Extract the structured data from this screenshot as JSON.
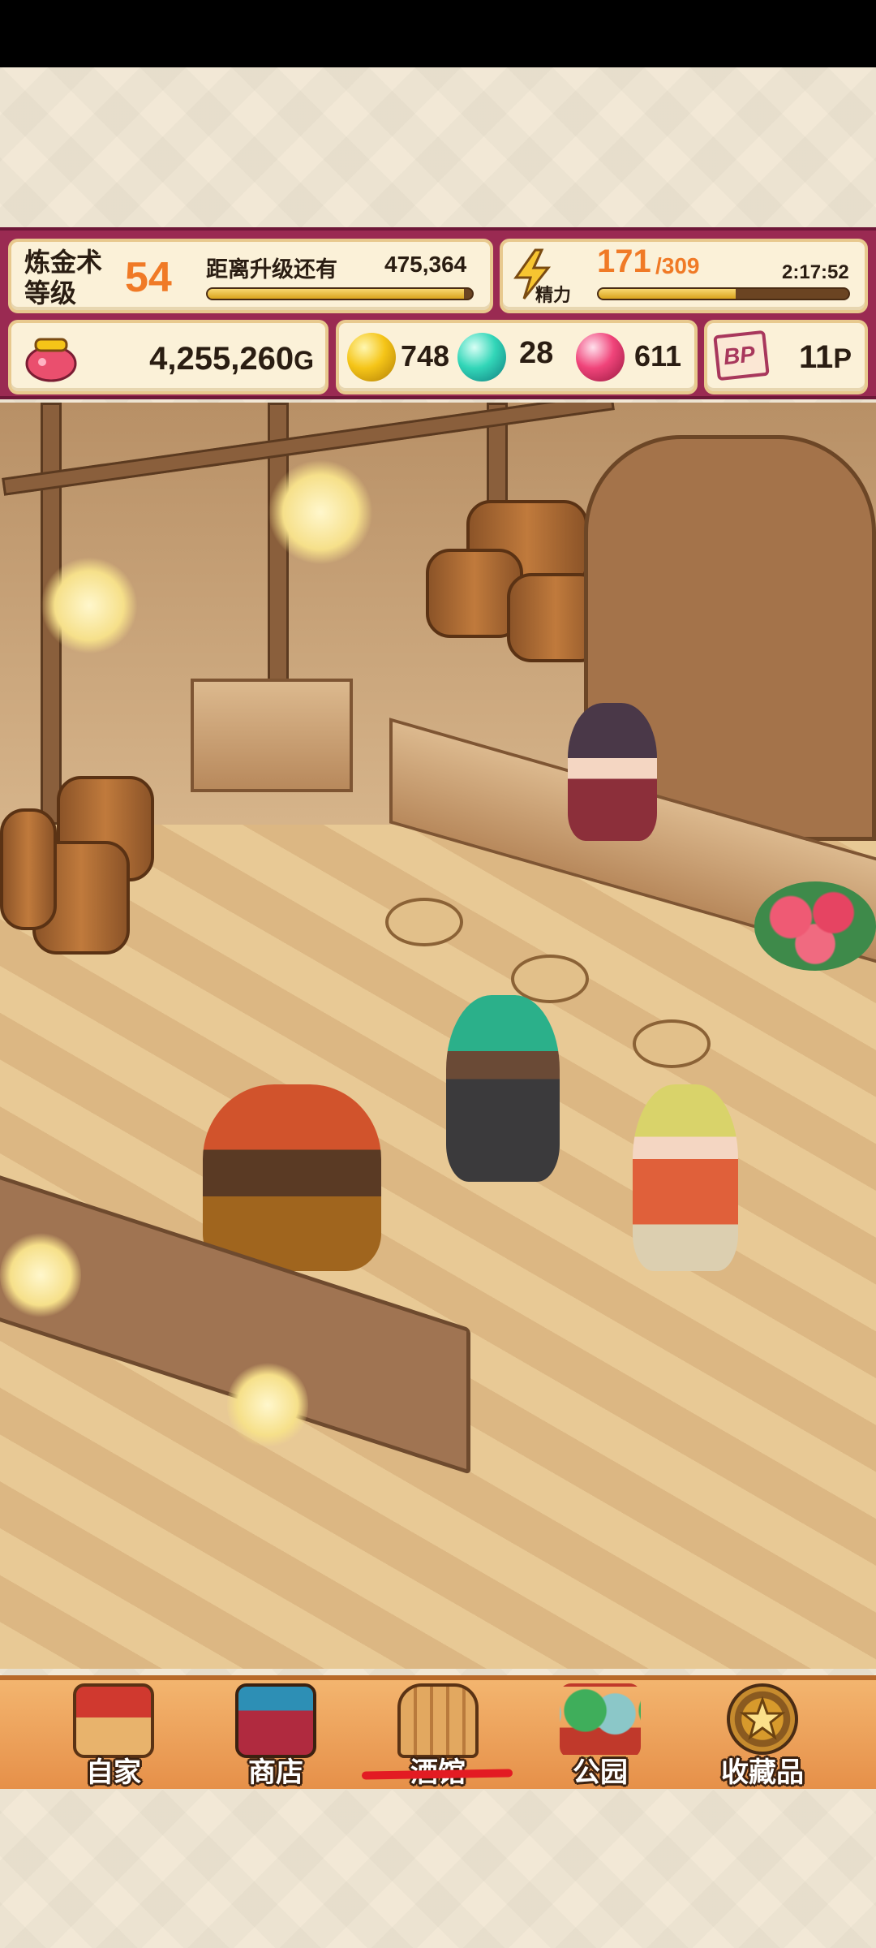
{
  "hud": {
    "alchemy_label": "炼金术\n等级",
    "alchemy_level": "54",
    "next_level_label": "距离升级还有",
    "next_level_value": "475,364",
    "exp_progress": 0.97,
    "energy_label": "精力",
    "energy_current": "171",
    "energy_max": "/309",
    "energy_timer": "2:17:52",
    "energy_progress": 0.55,
    "gold_value": "4,255,260",
    "gold_unit": "G",
    "gold_gem_count": "748",
    "cyan_gem_count": "28",
    "pink_gem_count": "611",
    "bp_icon_text": "BP",
    "bp_value": "11",
    "bp_unit": "P"
  },
  "nav": {
    "items": [
      {
        "label": "自家",
        "icon": "house-icon"
      },
      {
        "label": "商店",
        "icon": "shop-icon"
      },
      {
        "label": "酒馆",
        "icon": "tavern-door-icon"
      },
      {
        "label": "公园",
        "icon": "park-icon"
      },
      {
        "label": "收藏品",
        "icon": "star-medal-icon"
      }
    ],
    "active": "酒馆"
  },
  "colors": {
    "hud_bg": "#9a2a52",
    "level_orange": "#f07a26",
    "nav_bg": "#e69049",
    "active_underline": "#e31b23"
  }
}
